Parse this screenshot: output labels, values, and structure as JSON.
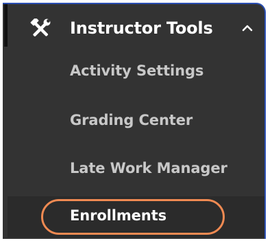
{
  "menu": {
    "header_label": "Instructor Tools",
    "header_icon": "tools-icon",
    "expanded": true,
    "items": [
      {
        "label": "Activity Settings",
        "selected": false
      },
      {
        "label": "Grading Center",
        "selected": false
      },
      {
        "label": "Late Work Manager",
        "selected": false
      },
      {
        "label": "Enrollments",
        "selected": true
      }
    ]
  },
  "colors": {
    "panel_background": "#333333",
    "header_text": "#ffffff",
    "item_text": "#c8c8c8",
    "selected_text": "#ffffff",
    "highlight_outline": "#f08a52",
    "panel_border": "#2b4fb3"
  }
}
